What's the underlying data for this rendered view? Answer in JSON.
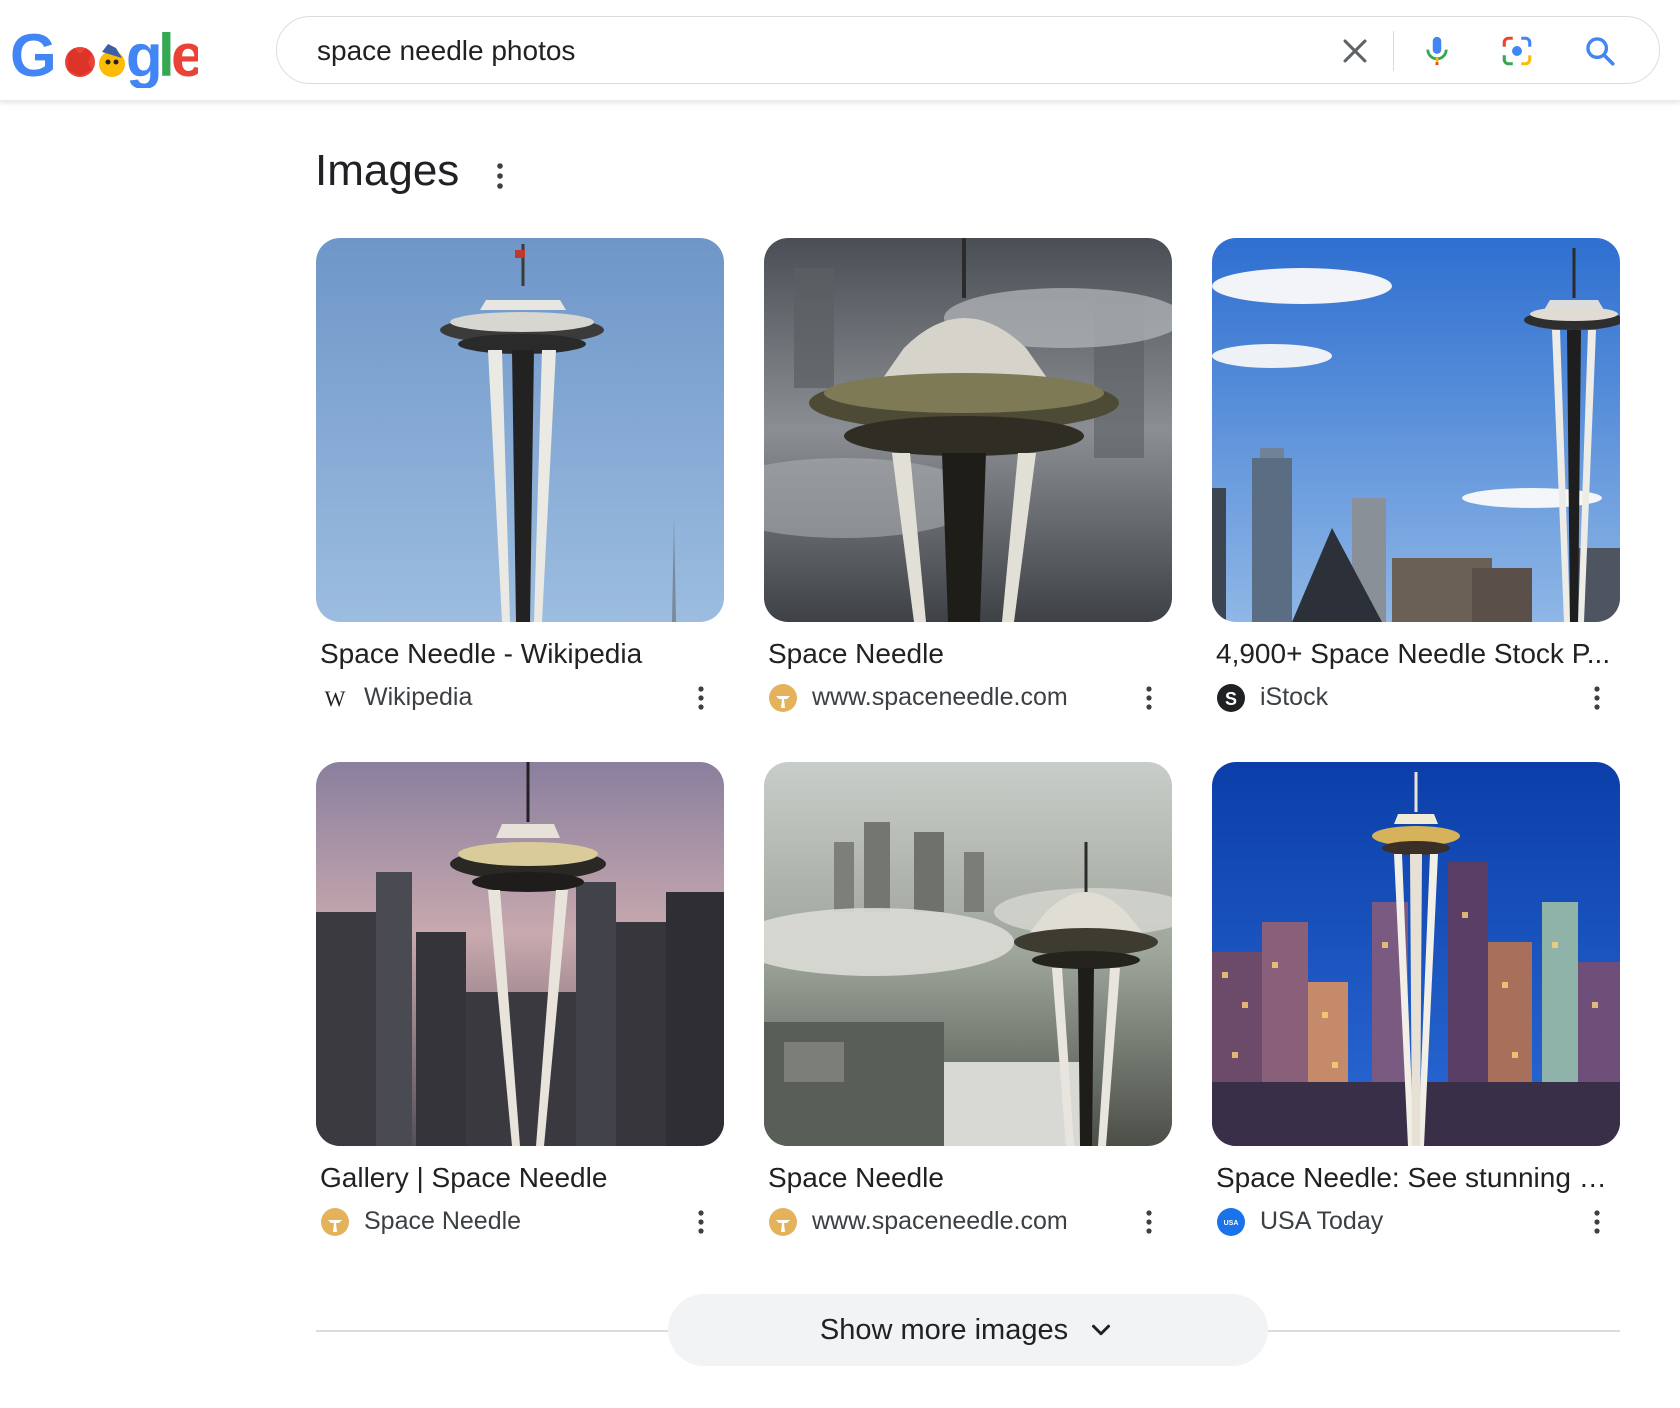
{
  "search": {
    "query": "space needle photos",
    "clear_icon": "close-icon",
    "voice_icon": "microphone-icon",
    "lens_icon": "google-lens-icon",
    "search_icon": "search-icon"
  },
  "logo": {
    "text": "Google",
    "style": "doodle"
  },
  "images_section": {
    "title": "Images",
    "menu_icon": "more-vert-icon",
    "results": [
      {
        "title": "Space Needle - Wikipedia",
        "source": "Wikipedia",
        "favicon": "wikipedia-icon"
      },
      {
        "title": "Space Needle",
        "source": "www.spaceneedle.com",
        "favicon": "spaceneedle-icon"
      },
      {
        "title": "4,900+ Space Needle Stock P...",
        "source": "iStock",
        "favicon": "istock-icon"
      },
      {
        "title": "Gallery | Space Needle",
        "source": "Space Needle",
        "favicon": "spaceneedle-icon"
      },
      {
        "title": "Space Needle",
        "source": "www.spaceneedle.com",
        "favicon": "spaceneedle-icon"
      },
      {
        "title": "Space Needle: See stunning p...",
        "source": "USA Today",
        "favicon": "usatoday-icon"
      }
    ]
  },
  "show_more": {
    "label": "Show more images",
    "icon": "chevron-down-icon"
  },
  "colors": {
    "blue": "#4285f4",
    "red": "#ea4335",
    "yellow": "#fbbc05",
    "green": "#34a853",
    "text": "#202124"
  }
}
